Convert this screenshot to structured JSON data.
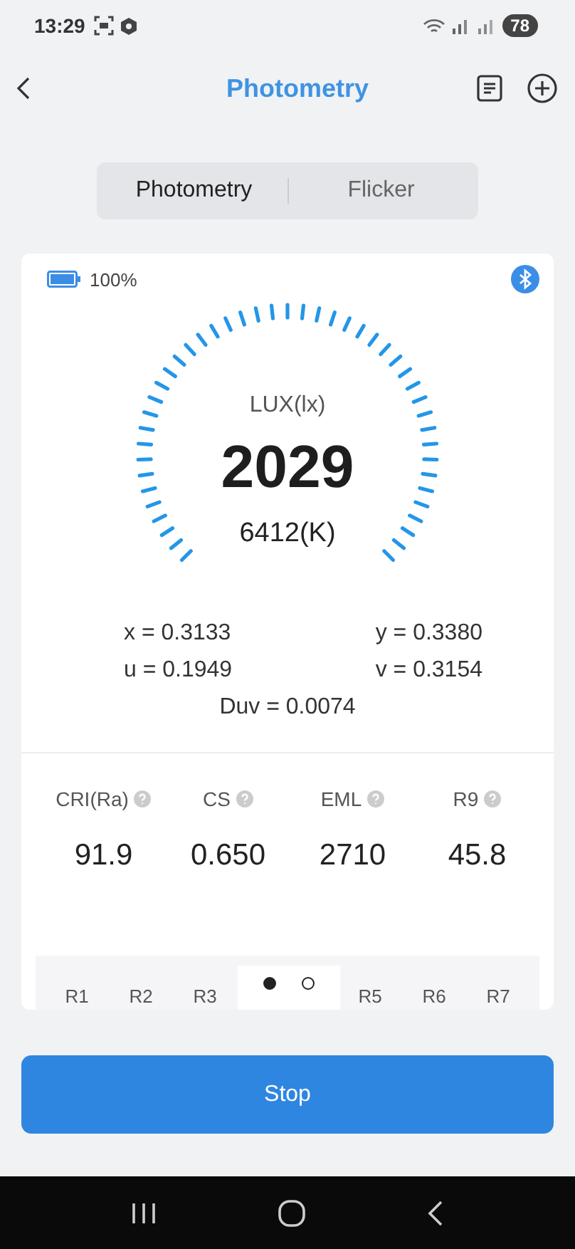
{
  "status_bar": {
    "time": "13:29",
    "battery": "78"
  },
  "header": {
    "title": "Photometry"
  },
  "tabs": [
    {
      "label": "Photometry",
      "selected": true
    },
    {
      "label": "Flicker",
      "selected": false
    }
  ],
  "device": {
    "battery_text": "100%",
    "battery": {
      "level": 1
    }
  },
  "gauge": {
    "unit": "LUX(lx)",
    "value": "2029",
    "cct": "6412(K)"
  },
  "coords": [
    {
      "text": "x = 0.3133"
    },
    {
      "text": "y = 0.3380"
    },
    {
      "text": "u = 0.1949"
    },
    {
      "text": "v = 0.3154"
    }
  ],
  "duv": "Duv = 0.0074",
  "metrics": [
    {
      "label": "CRI(Ra)",
      "value": "91.9"
    },
    {
      "label": "CS",
      "value": "0.650"
    },
    {
      "label": "EML",
      "value": "2710"
    },
    {
      "label": "R9",
      "value": "45.8"
    }
  ],
  "pager": [
    {
      "selected": true
    },
    {
      "selected": false
    }
  ],
  "r_values": [
    {
      "label": "R1"
    },
    {
      "label": "R2"
    },
    {
      "label": "R3"
    },
    {
      "label": "R5"
    },
    {
      "label": "R6"
    },
    {
      "label": "R7"
    }
  ],
  "stop_button": "Stop"
}
